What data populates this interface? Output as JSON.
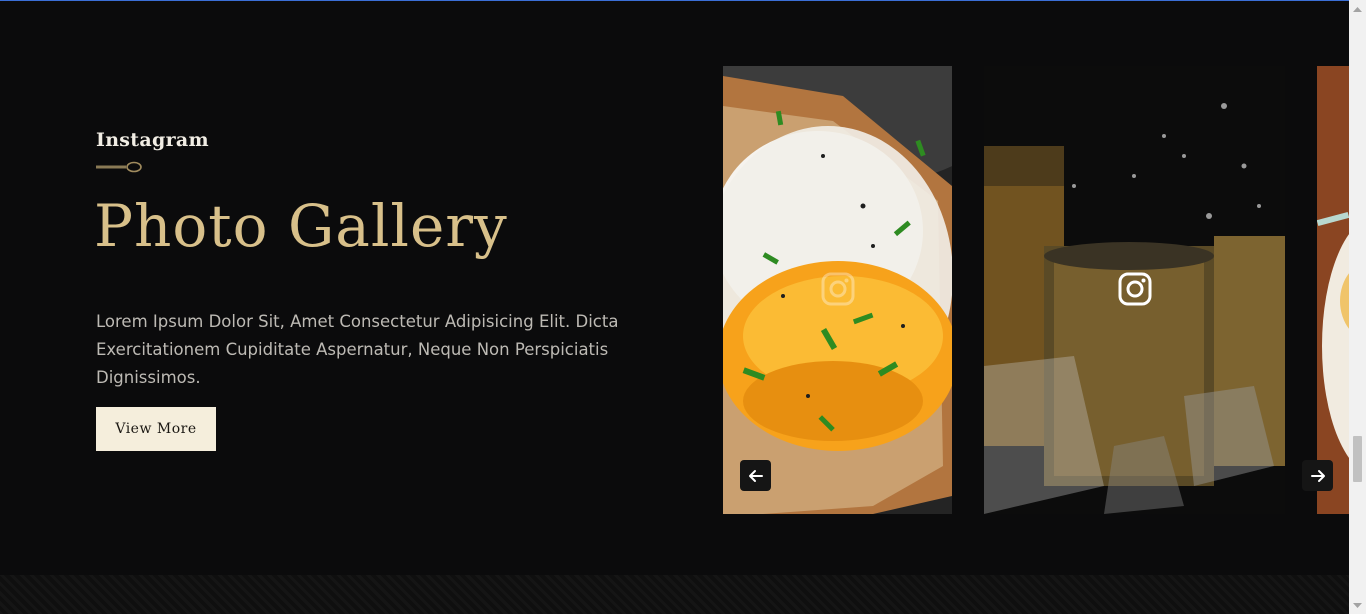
{
  "section": {
    "eyebrow": "Instagram",
    "title": "Photo Gallery",
    "description": "Lorem Ipsum Dolor Sit, Amet Consectetur Adipisicing Elit. Dicta Exercitationem Cupiditate Aspernatur, Neque Non Perspiciatis Dignissimos.",
    "cta_label": "View More"
  },
  "gallery": {
    "slides": [
      {
        "subject": "fried egg on toast",
        "icon": "instagram-icon"
      },
      {
        "subject": "whiskey glasses with ice",
        "icon": "instagram-icon"
      },
      {
        "subject": "soup bowl (partially visible)",
        "icon": "instagram-icon"
      }
    ],
    "prev_icon": "arrow-left-icon",
    "next_icon": "arrow-right-icon"
  },
  "colors": {
    "background": "#0b0b0c",
    "accent_gold": "#d8c08a",
    "button_bg": "#f5eedc",
    "text_muted": "#bdbab4"
  }
}
